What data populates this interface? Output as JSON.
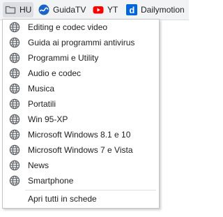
{
  "bookmarks_bar": {
    "items": [
      {
        "label": "HU",
        "icon": "folder-icon"
      },
      {
        "label": "GuidaTV",
        "icon": "guidatv-icon"
      },
      {
        "label": "YT",
        "icon": "youtube-icon"
      },
      {
        "label": "Dailymotion",
        "icon": "dailymotion-icon"
      }
    ]
  },
  "folder_menu": {
    "items": [
      {
        "label": "Editing e codec video",
        "icon": "globe-icon"
      },
      {
        "label": "Guida ai programmi antivirus",
        "icon": "globe-icon"
      },
      {
        "label": "Programmi e Utility",
        "icon": "globe-icon"
      },
      {
        "label": "Audio e codec",
        "icon": "globe-icon"
      },
      {
        "label": "Musica",
        "icon": "globe-icon"
      },
      {
        "label": "Portatili",
        "icon": "globe-icon"
      },
      {
        "label": "Win 95-XP",
        "icon": "globe-icon"
      },
      {
        "label": "Microsoft Windows 8.1 e 10",
        "icon": "globe-icon"
      },
      {
        "label": "Microsoft Windows 7 e Vista",
        "icon": "globe-icon"
      },
      {
        "label": "News",
        "icon": "globe-icon"
      },
      {
        "label": "Smartphone",
        "icon": "globe-icon"
      }
    ],
    "open_all": "Apri tutti in schede"
  },
  "colors": {
    "guidatv_blue": "#1a63c7",
    "youtube_red": "#ff0000",
    "dailymotion_blue": "#0066dc",
    "globe_grey": "#5f6368"
  }
}
